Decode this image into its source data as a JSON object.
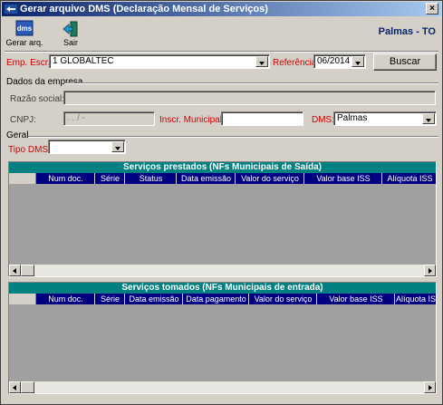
{
  "window": {
    "title": "Gerar arquivo DMS (Declaração Mensal de Serviços)",
    "close_glyph": "×"
  },
  "toolbar": {
    "generate_label": "Gerar arq.",
    "generate_icon_text": "dms",
    "exit_label": "Sair",
    "city_label": "Palmas - TO"
  },
  "filters": {
    "company_label": "Emp. Escr.:",
    "company_value": "1 GLOBALTEC",
    "reference_label": "Referência:",
    "reference_value": "06/2014",
    "search_label": "Buscar"
  },
  "company_data": {
    "section_label": "Dados da empresa",
    "razao_label": "Razão social:",
    "razao_value": "",
    "cnpj_label": "CNPJ:",
    "cnpj_value": "  .   .   /    -",
    "inscr_label": "Inscr. Municipal:",
    "inscr_value": "",
    "dms_label": "DMS:",
    "dms_value": "Palmas"
  },
  "general": {
    "section_label": "Geral",
    "tipo_label": "Tipo DMS:",
    "tipo_value": ""
  },
  "grid_prestados": {
    "title": "Serviços prestados (NFs Municipais de Saída)",
    "columns": [
      "Num doc.",
      "Série",
      "Status",
      "Data emissão",
      "Valor do serviço",
      "Valor base ISS",
      "Alíquota ISS"
    ]
  },
  "grid_tomados": {
    "title": "Serviços tomados (NFs Municipais de entrada)",
    "columns": [
      "Num doc.",
      "Série",
      "Data emissão",
      "Data pagamento",
      "Valor do serviço",
      "Valor base ISS",
      "Alíquota ISS"
    ]
  },
  "colors": {
    "required_label": "#d40000",
    "grid_title_bg": "#008080",
    "grid_header_bg": "#000080",
    "city_text": "#0a246a"
  }
}
